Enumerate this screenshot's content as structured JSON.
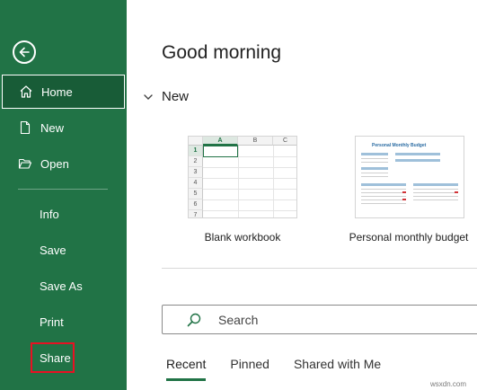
{
  "sidebar": {
    "back_icon": "back-arrow-icon",
    "items": [
      {
        "label": "Home",
        "icon": "home-icon"
      },
      {
        "label": "New",
        "icon": "new-document-icon"
      },
      {
        "label": "Open",
        "icon": "open-folder-icon"
      },
      {
        "label": "Info"
      },
      {
        "label": "Save"
      },
      {
        "label": "Save As"
      },
      {
        "label": "Print"
      },
      {
        "label": "Share"
      }
    ],
    "bg_color": "#217346",
    "active_color": "#185c37",
    "highlight_color": "#e81123"
  },
  "main": {
    "greeting": "Good morning",
    "new_section": {
      "title": "New"
    },
    "templates": [
      {
        "label": "Blank workbook"
      },
      {
        "label": "Personal monthly budget"
      }
    ],
    "blank_grid": {
      "columns": [
        "A",
        "B",
        "C"
      ],
      "rows": [
        "1",
        "2",
        "3",
        "4",
        "5",
        "6",
        "7"
      ]
    },
    "budget_thumb_title": "Personal Monthly Budget",
    "search": {
      "placeholder": "Search"
    },
    "tabs": [
      {
        "label": "Recent",
        "active": true
      },
      {
        "label": "Pinned"
      },
      {
        "label": "Shared with Me"
      }
    ]
  },
  "watermark": "wsxdn.com"
}
